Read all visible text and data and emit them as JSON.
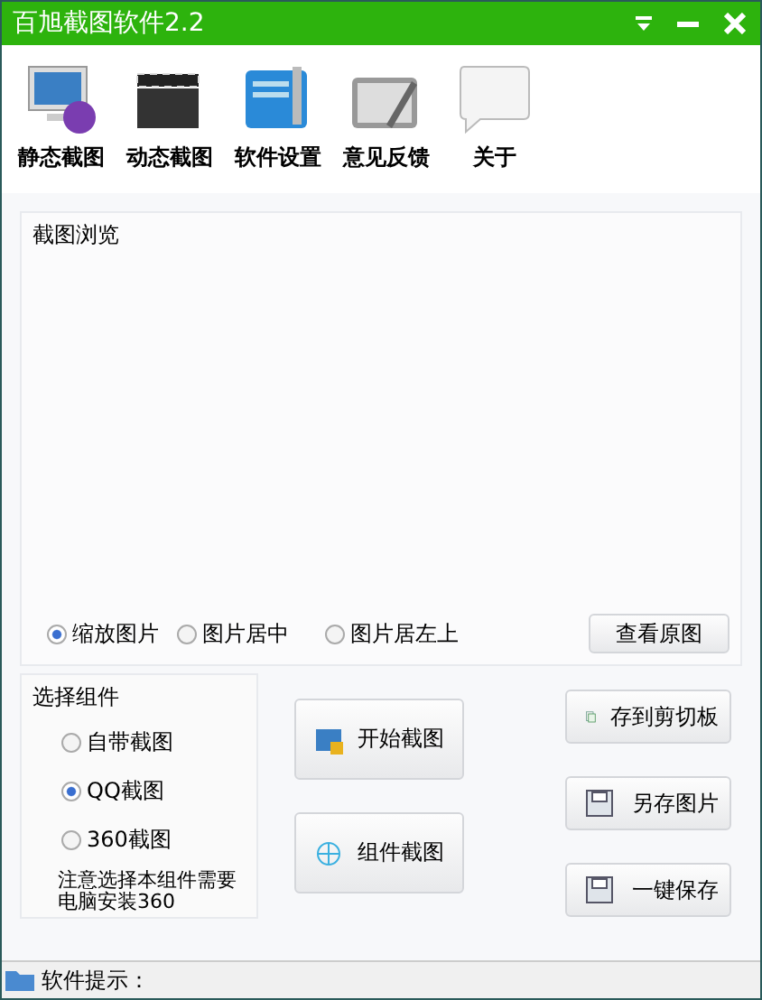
{
  "window": {
    "title": "百旭截图软件2.2"
  },
  "toolbar": [
    {
      "label": "静态截图",
      "kind": "monitor"
    },
    {
      "label": "动态截图",
      "kind": "clapper"
    },
    {
      "label": "软件设置",
      "kind": "settings"
    },
    {
      "label": "意见反馈",
      "kind": "tablet"
    },
    {
      "label": "关于",
      "kind": "bubble"
    }
  ],
  "preview": {
    "title": "截图浏览",
    "modes": [
      {
        "label": "缩放图片",
        "selected": true
      },
      {
        "label": "图片居中",
        "selected": false
      },
      {
        "label": "图片居左上",
        "selected": false
      }
    ],
    "view_button": "查看原图"
  },
  "components": {
    "title": "选择组件",
    "options": [
      {
        "label": "自带截图",
        "selected": false
      },
      {
        "label": "QQ截图",
        "selected": true
      },
      {
        "label": "360截图",
        "selected": false
      }
    ],
    "note": "注意选择本组件需要电脑安装360"
  },
  "actions": [
    {
      "label": "开始截图",
      "kind": "start"
    },
    {
      "label": "组件截图",
      "kind": "component"
    }
  ],
  "save_actions": [
    {
      "label": "存到剪切板",
      "kind": "clipboard"
    },
    {
      "label": "另存图片",
      "kind": "disk"
    },
    {
      "label": "一键保存",
      "kind": "disk"
    }
  ],
  "status_bar": {
    "label": "软件提示："
  }
}
